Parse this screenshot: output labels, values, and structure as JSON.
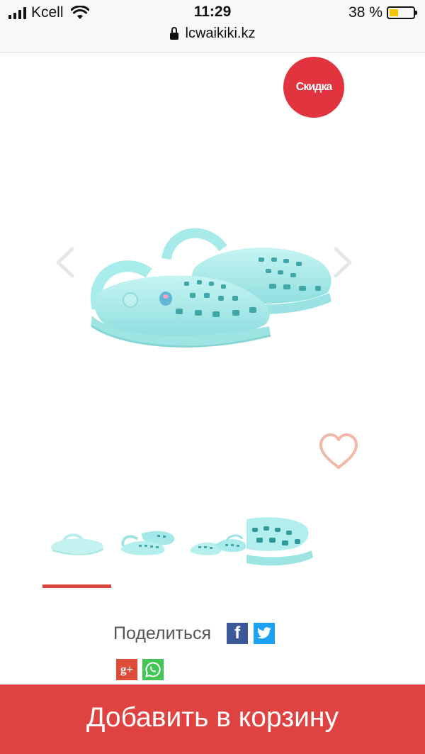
{
  "status_bar": {
    "carrier": "Kcell",
    "time": "11:29",
    "battery_text": "38 %",
    "battery_level": 0.38,
    "signal_bars": 4,
    "url": "lcwaikiki.kz"
  },
  "product": {
    "badge_text": "Скидка",
    "image_icon": "aqua-kids-clogs",
    "favorite_icon": "heart-outline-icon",
    "thumbnails": [
      "thumb-1",
      "thumb-2",
      "thumb-3",
      "thumb-4"
    ],
    "active_thumbnail": 0
  },
  "share": {
    "label": "Поделиться",
    "facebook_glyph": "f",
    "google_plus_glyph": "g+"
  },
  "cart": {
    "button_label": "Добавить в корзину"
  },
  "colors": {
    "accent_red": "#df4341",
    "badge_red": "#e2343f",
    "product_aqua": "#aeeeed"
  }
}
